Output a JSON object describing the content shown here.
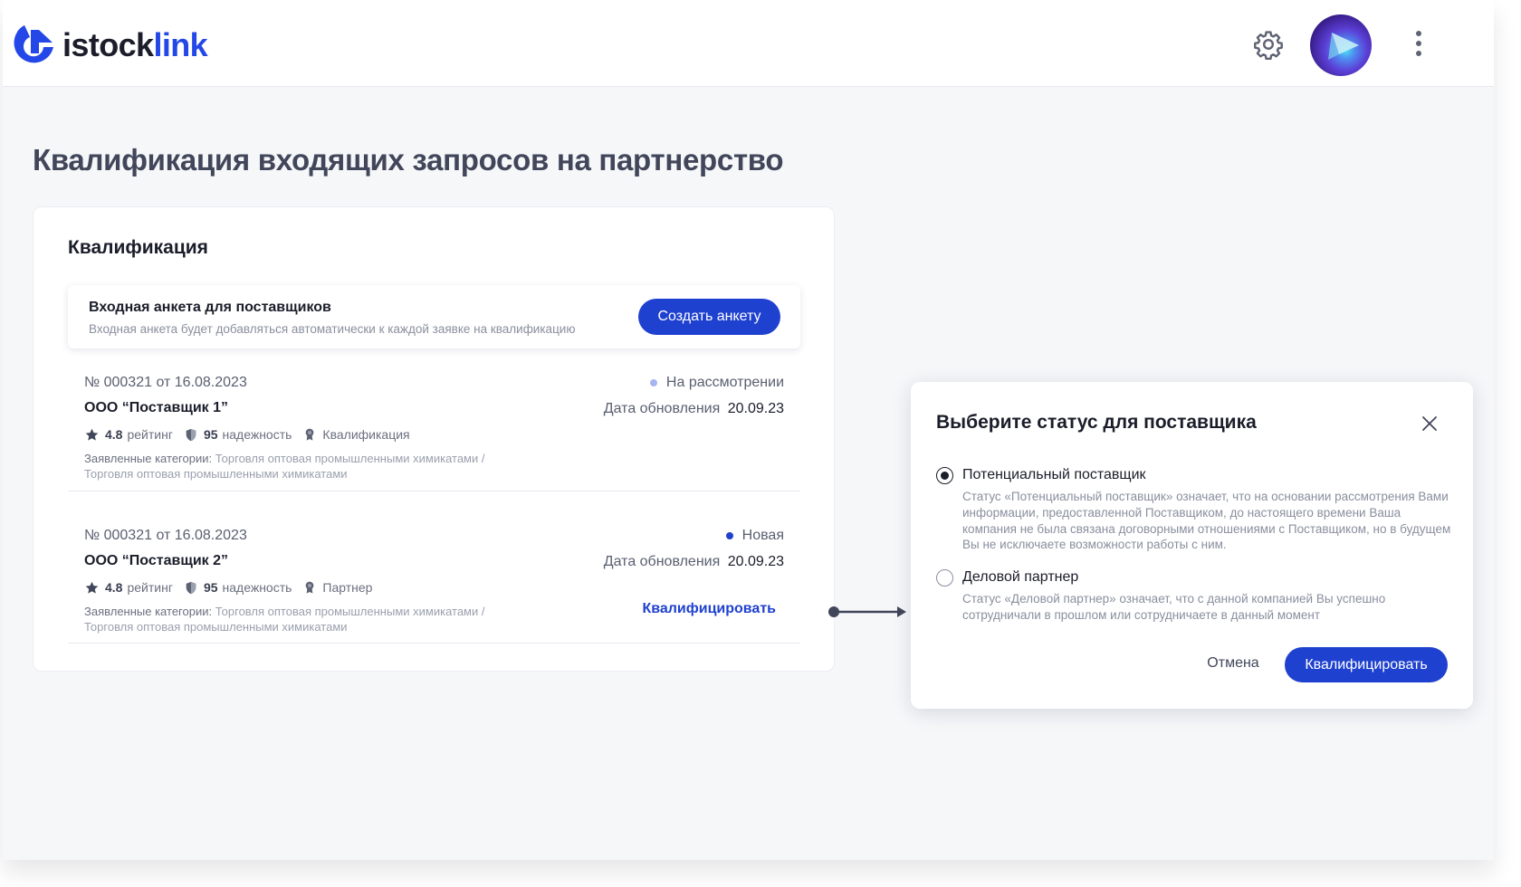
{
  "brand": {
    "name_part1": "istock",
    "name_part2": "link",
    "accent": "#2448e8"
  },
  "header": {
    "icons": [
      "gear-icon",
      "avatar",
      "kebab-menu-icon"
    ]
  },
  "page": {
    "title": "Квалификация входящих запросов на партнерство"
  },
  "card": {
    "title": "Квалификация",
    "questionnaire": {
      "title": "Входная анкета для поставщиков",
      "subtitle": "Входная анкета будет добавляться автоматически к каждой заявке на квалификацию",
      "button_label": "Создать анкету"
    },
    "requests": [
      {
        "number": "№ 000321 от 16.08.2023",
        "company": "ООО “Поставщик 1”",
        "status": "На рассмотрении",
        "status_color": "#a7b5f0",
        "updated_label": "Дата обновления",
        "updated_date": "20.09.23",
        "rating_value": "4.8",
        "rating_label": "рейтинг",
        "reliability_value": "95",
        "reliability_label": "надежность",
        "tag": "Квалификация",
        "categories_label": "Заявленные категории:",
        "categories_line1": "Торговля оптовая промышленными химикатами  /",
        "categories_line2": "Торговля оптовая промышленными химикатами"
      },
      {
        "number": "№ 000321 от 16.08.2023",
        "company": "ООО “Поставщик 2”",
        "status": "Новая",
        "status_color": "#1f41cf",
        "updated_label": "Дата обновления",
        "updated_date": "20.09.23",
        "rating_value": "4.8",
        "rating_label": "рейтинг",
        "reliability_value": "95",
        "reliability_label": "надежность",
        "tag": "Партнер",
        "categories_label": "Заявленные категории:",
        "categories_line1": "Торговля оптовая промышленными химикатами  /",
        "categories_line2": "Торговля оптовая промышленными химикатами",
        "action_label": "Квалифицировать"
      }
    ]
  },
  "modal": {
    "title": "Выберите статус для поставщика",
    "options": [
      {
        "label": "Потенциальный поставщик",
        "selected": true,
        "description": "Статус «Потенциальный поставщик» означает, что на основании рассмотрения Вами информации, предоставленной Поставщиком, до настоящего времени Ваша компания не была связана договорными отношениями с Поставщиком, но в будущем Вы не исключаете возможности работы с ним."
      },
      {
        "label": "Деловой партнер",
        "selected": false,
        "description": "Статус «Деловой партнер» означает, что с данной компанией Вы успешно сотрудничали в прошлом или сотрудничаете в данный момент"
      }
    ],
    "cancel_label": "Отмена",
    "confirm_label": "Квалифицировать"
  }
}
